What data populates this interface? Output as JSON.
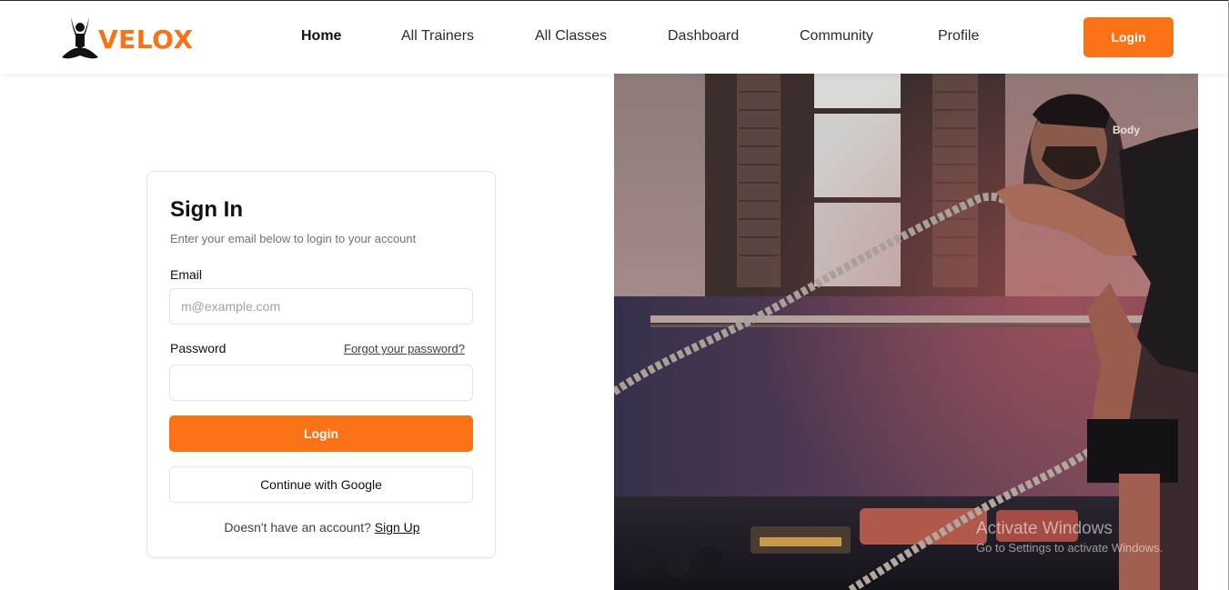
{
  "brand": {
    "name": "VELOX",
    "logo_icon": "meditation-figure-icon",
    "accent": "#f97316"
  },
  "nav": {
    "items": [
      {
        "label": "Home",
        "active": true
      },
      {
        "label": "All Trainers",
        "active": false
      },
      {
        "label": "All Classes",
        "active": false
      },
      {
        "label": "Dashboard",
        "active": false
      },
      {
        "label": "Community",
        "active": false
      },
      {
        "label": "Profile",
        "active": false
      }
    ],
    "login_label": "Login"
  },
  "signin": {
    "title": "Sign In",
    "subtitle": "Enter your email below to login to your account",
    "email_label": "Email",
    "email_placeholder": "m@example.com",
    "email_value": "",
    "password_label": "Password",
    "password_value": "",
    "forgot_label": "Forgot your password?",
    "login_label": "Login",
    "google_label": "Continue with Google",
    "no_account_text": "Doesn't have an account?",
    "signup_label": "Sign Up"
  },
  "hero": {
    "alt_icon": "battle-ropes-workout-photo"
  },
  "watermark": {
    "title": "Activate Windows",
    "subtitle": "Go to Settings to activate Windows."
  }
}
